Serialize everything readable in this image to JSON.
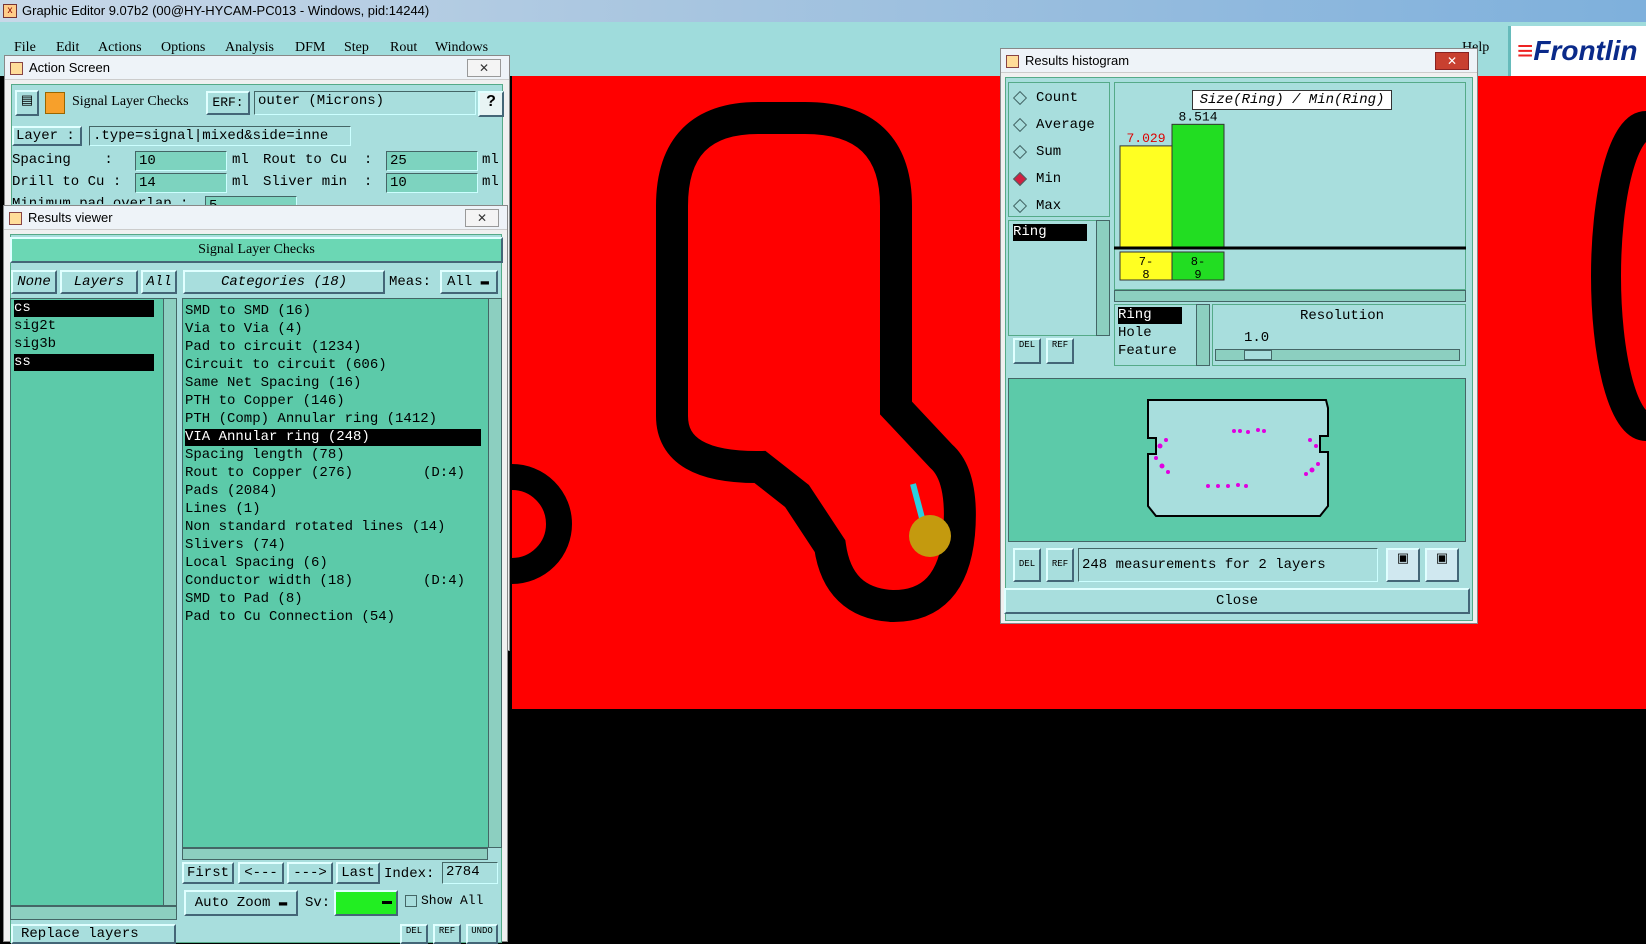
{
  "app_title": "Graphic Editor 9.07b2 (00@HY-HYCAM-PC013 - Windows, pid:14244)",
  "menu": [
    "File",
    "Edit",
    "Actions",
    "Options",
    "Analysis",
    "DFM",
    "Step",
    "Rout",
    "Windows"
  ],
  "help_label": "Help",
  "logo_text": "Frontlin",
  "action_screen": {
    "title": "Action Screen",
    "check_name": "Signal Layer Checks",
    "erf_label": "ERF:",
    "erf_value": "outer (Microns)",
    "help_btn": "?",
    "layer_label": "Layer :",
    "layer_value": ".type=signal|mixed&side=inne",
    "spacing_label": "Spacing    :",
    "spacing_value": "10",
    "unit_ml": "ml",
    "rout_label": "Rout to Cu  :",
    "rout_value": "25",
    "drill_label": "Drill to Cu :",
    "drill_value": "14",
    "sliver_label": "Sliver min  :",
    "sliver_value": "10",
    "minpad_label": "Minimum pad overlap :",
    "minpad_value": "5"
  },
  "results_viewer": {
    "title": "Results viewer",
    "header": "Signal Layer Checks",
    "none_btn": "None",
    "layers_btn": "Layers",
    "all_btn": "All",
    "categories_btn": "Categories (18)",
    "meas_label": "Meas:",
    "meas_value": "All",
    "layers": [
      {
        "name": "cs",
        "selected": true
      },
      {
        "name": "sig2t",
        "selected": false
      },
      {
        "name": "sig3b",
        "selected": false
      },
      {
        "name": "ss",
        "selected": true
      }
    ],
    "categories": [
      {
        "label": "SMD to SMD (16)",
        "extra": "",
        "selected": false
      },
      {
        "label": "Via to Via (4)",
        "extra": "",
        "selected": false
      },
      {
        "label": "Pad to circuit (1234)",
        "extra": "",
        "selected": false
      },
      {
        "label": "Circuit to circuit (606)",
        "extra": "",
        "selected": false
      },
      {
        "label": "Same Net Spacing (16)",
        "extra": "",
        "selected": false
      },
      {
        "label": "PTH to Copper (146)",
        "extra": "",
        "selected": false
      },
      {
        "label": "PTH (Comp) Annular ring (1412)",
        "extra": "",
        "selected": false
      },
      {
        "label": "VIA Annular ring (248)",
        "extra": "",
        "selected": true
      },
      {
        "label": "Spacing length (78)",
        "extra": "",
        "selected": false
      },
      {
        "label": "Rout to Copper (276)",
        "extra": "(D:4)",
        "selected": false
      },
      {
        "label": "Pads (2084)",
        "extra": "",
        "selected": false
      },
      {
        "label": "Lines (1)",
        "extra": "",
        "selected": false
      },
      {
        "label": "Non standard rotated lines (14)",
        "extra": "",
        "selected": false
      },
      {
        "label": "Slivers (74)",
        "extra": "",
        "selected": false
      },
      {
        "label": "Local Spacing (6)",
        "extra": "",
        "selected": false
      },
      {
        "label": "Conductor width (18)",
        "extra": "(D:4)",
        "selected": false
      },
      {
        "label": "SMD to Pad (8)",
        "extra": "",
        "selected": false
      },
      {
        "label": "Pad to Cu Connection (54)",
        "extra": "",
        "selected": false
      }
    ],
    "first_btn": "First",
    "prev_btn": "<---",
    "next_btn": "--->",
    "last_btn": "Last",
    "index_label": "Index:",
    "index_value": "2784",
    "auto_zoom": "Auto Zoom",
    "sv_label": "Sv:",
    "show_all": "Show All",
    "replace_layers": "Replace layers",
    "del_btn": "DEL",
    "ref_btn": "REF",
    "undo_btn": "UNDO"
  },
  "histogram": {
    "title": "Results histogram",
    "modes": [
      {
        "label": "Count",
        "selected": false
      },
      {
        "label": "Average",
        "selected": false
      },
      {
        "label": "Sum",
        "selected": false
      },
      {
        "label": "Min",
        "selected": true
      },
      {
        "label": "Max",
        "selected": false
      }
    ],
    "left_list": [
      "Ring"
    ],
    "chart_title": "Size(Ring) / Min(Ring)",
    "del_btn": "DEL",
    "ref_btn": "REF",
    "types": [
      {
        "label": "Ring",
        "selected": true
      },
      {
        "label": "Hole",
        "selected": false
      },
      {
        "label": "Feature",
        "selected": false
      }
    ],
    "resolution_label": "Resolution",
    "resolution_value": "1.0",
    "status": "248 measurements for 2 layers",
    "close_btn": "Close",
    "colors": {
      "bar1": "#ffff22",
      "bar2": "#22dd22",
      "label1": "#dd0000"
    }
  },
  "chart_data": {
    "type": "bar",
    "title": "Size(Ring) / Min(Ring)",
    "categories": [
      "7-8",
      "8-9"
    ],
    "category_lines": [
      [
        "7-",
        "8"
      ],
      [
        "8-",
        "9"
      ]
    ],
    "values": [
      7.029,
      8.514
    ],
    "value_labels": [
      "7.029",
      "8.514"
    ],
    "ylim": [
      0,
      9.5
    ],
    "xlabel": "",
    "ylabel": ""
  }
}
